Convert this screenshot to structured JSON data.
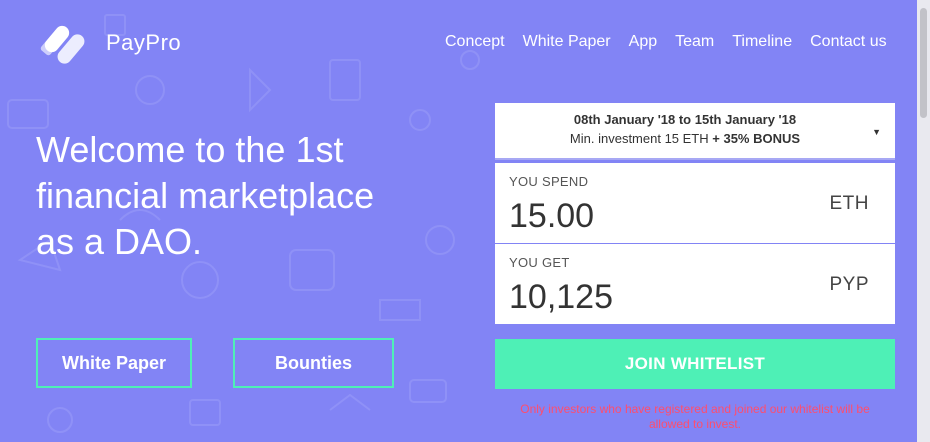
{
  "brand": {
    "name": "PayPro"
  },
  "nav": {
    "items": [
      {
        "label": "Concept"
      },
      {
        "label": "White Paper"
      },
      {
        "label": "App"
      },
      {
        "label": "Team"
      },
      {
        "label": "Timeline"
      },
      {
        "label": "Contact us"
      }
    ]
  },
  "hero": {
    "title": "Welcome to the 1st financial marketplace as a DAO.",
    "buttons": {
      "white_paper": "White Paper",
      "bounties": "Bounties"
    }
  },
  "widget": {
    "period": {
      "dates": "08th January '18 to 15th January '18",
      "min_investment": "Min. investment 15 ETH",
      "bonus": "+ 35% BONUS"
    },
    "spend": {
      "label": "YOU SPEND",
      "value": "15.00",
      "unit": "ETH"
    },
    "get": {
      "label": "YOU GET",
      "value": "10,125",
      "unit": "PYP"
    },
    "join_button": "JOIN WHITELIST",
    "notice": "Only investors who have registered and joined our whitelist will be allowed to invest."
  },
  "colors": {
    "background": "#8284f5",
    "accent": "#4ef0b6",
    "notice": "#ff4d6d",
    "panel": "#ffffff"
  },
  "icons": {
    "logo": "paypro-logo-mark",
    "dropdown": "caret-down-icon"
  }
}
